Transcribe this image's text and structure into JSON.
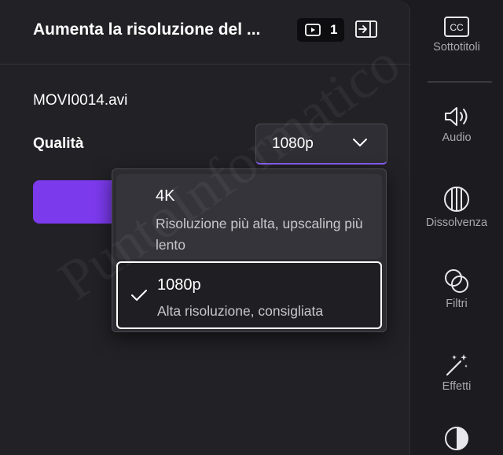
{
  "panel": {
    "title": "Aumenta la risoluzione del ...",
    "clip_count": "1",
    "file_name": "MOVI0014.avi",
    "quality_label": "Qualità",
    "quality_value": "1080p"
  },
  "dropdown": {
    "options": [
      {
        "title": "4K",
        "description": "Risoluzione più alta, upscaling più lento",
        "selected": false
      },
      {
        "title": "1080p",
        "description": "Alta risoluzione, consigliata",
        "selected": true
      }
    ]
  },
  "sidebar": {
    "items": [
      {
        "label": "Sottotitoli",
        "icon": "cc-icon"
      },
      {
        "label": "Audio",
        "icon": "speaker-icon"
      },
      {
        "label": "Dissolvenza",
        "icon": "fade-icon"
      },
      {
        "label": "Filtri",
        "icon": "filters-icon"
      },
      {
        "label": "Effetti",
        "icon": "magic-wand-icon"
      },
      {
        "label": "",
        "icon": "contrast-icon"
      }
    ]
  },
  "watermark": "PuntoInformatico",
  "colors": {
    "accent": "#7c3aed",
    "panel_bg": "#222226",
    "sidebar_bg": "#1c1c20"
  }
}
